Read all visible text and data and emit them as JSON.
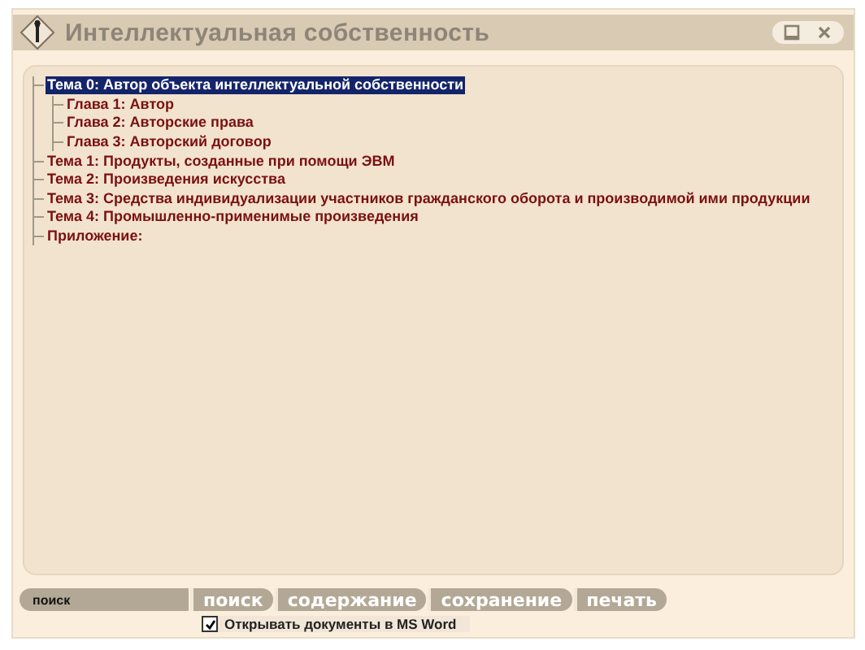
{
  "window": {
    "title": "Интеллектуальная собственность"
  },
  "tree": [
    {
      "label": "Тема 0: Автор объекта интеллектуальной собственности",
      "selected": true,
      "children": [
        {
          "label": "Глава 1: Автор",
          "selected": false
        },
        {
          "label": "Глава 2: Авторские права",
          "selected": false
        },
        {
          "label": "Глава 3: Авторский договор",
          "selected": false
        }
      ]
    },
    {
      "label": "Тема 1: Продукты, созданные при помощи ЭВМ",
      "selected": false
    },
    {
      "label": "Тема 2: Произведения искусства",
      "selected": false
    },
    {
      "label": "Тема 3: Средства индивидуализации участников гражданского оборота и производимой ими продукции",
      "selected": false
    },
    {
      "label": "Тема 4: Промышленно-применимые произведения",
      "selected": false
    },
    {
      "label": "Приложение:",
      "selected": false
    }
  ],
  "search": {
    "value": "поиск"
  },
  "buttons": [
    "поиск",
    "содержание",
    "сохранение",
    "печать"
  ],
  "option": {
    "label": "Открывать документы в MS Word",
    "checked": true
  }
}
